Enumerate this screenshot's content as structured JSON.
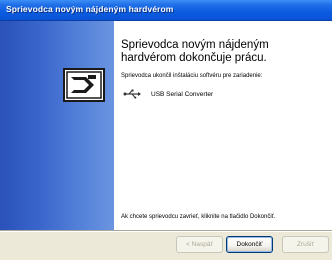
{
  "window": {
    "title": "Sprievodca novým nájdeným hardvérom"
  },
  "main": {
    "heading": "Sprievodca novým nájdeným hardvérom dokončuje prácu.",
    "subtext": "Sprievodca ukončil inštaláciu softvéru pre zariadenie:",
    "device_name": "USB Serial Converter",
    "bottom_text": "Ak chcete sprievodcu zavrieť, kliknite na tlačidlo Dokončiť."
  },
  "buttons": {
    "back": "< Naspäť",
    "finish": "Dokončiť",
    "cancel": "Zrušiť"
  },
  "icons": {
    "wizard": "hardware-wizard-icon",
    "usb": "usb-icon"
  },
  "colors": {
    "title_bar": "#0b5ce1",
    "left_band": "#3a66cc",
    "window_bg": "#ece9d8"
  }
}
